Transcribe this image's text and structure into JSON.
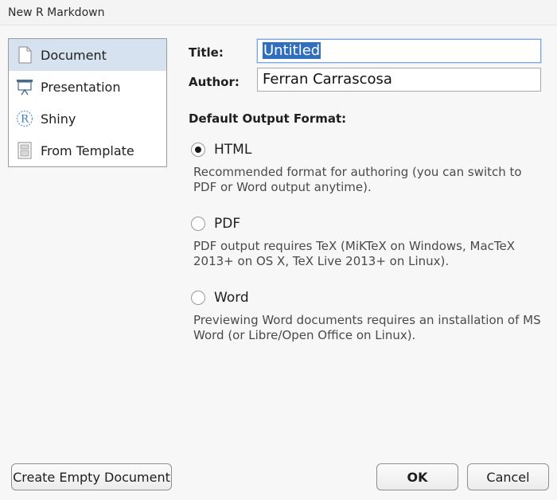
{
  "window": {
    "title": "New R Markdown"
  },
  "sidebar": {
    "items": [
      {
        "label": "Document",
        "icon": "document-icon",
        "selected": true
      },
      {
        "label": "Presentation",
        "icon": "presentation-icon",
        "selected": false
      },
      {
        "label": "Shiny",
        "icon": "shiny-r-icon",
        "selected": false
      },
      {
        "label": "From Template",
        "icon": "template-icon",
        "selected": false
      }
    ]
  },
  "form": {
    "title_label": "Title:",
    "title_value": "Untitled",
    "author_label": "Author:",
    "author_value": "Ferran Carrascosa"
  },
  "output": {
    "heading": "Default Output Format:",
    "options": [
      {
        "label": "HTML",
        "selected": true,
        "description": "Recommended format for authoring (you can switch to PDF or Word output anytime)."
      },
      {
        "label": "PDF",
        "selected": false,
        "description": "PDF output requires TeX (MiKTeX on Windows, MacTeX 2013+ on OS X, TeX Live 2013+ on Linux)."
      },
      {
        "label": "Word",
        "selected": false,
        "description": "Previewing Word documents requires an installation of MS Word (or Libre/Open Office on Linux)."
      }
    ]
  },
  "buttons": {
    "create_empty": "Create Empty Document",
    "ok": "OK",
    "cancel": "Cancel"
  },
  "colors": {
    "selection_bg": "#d6e2f0",
    "text_highlight": "#2f6fbd",
    "focus_border": "#7ea6d8"
  }
}
